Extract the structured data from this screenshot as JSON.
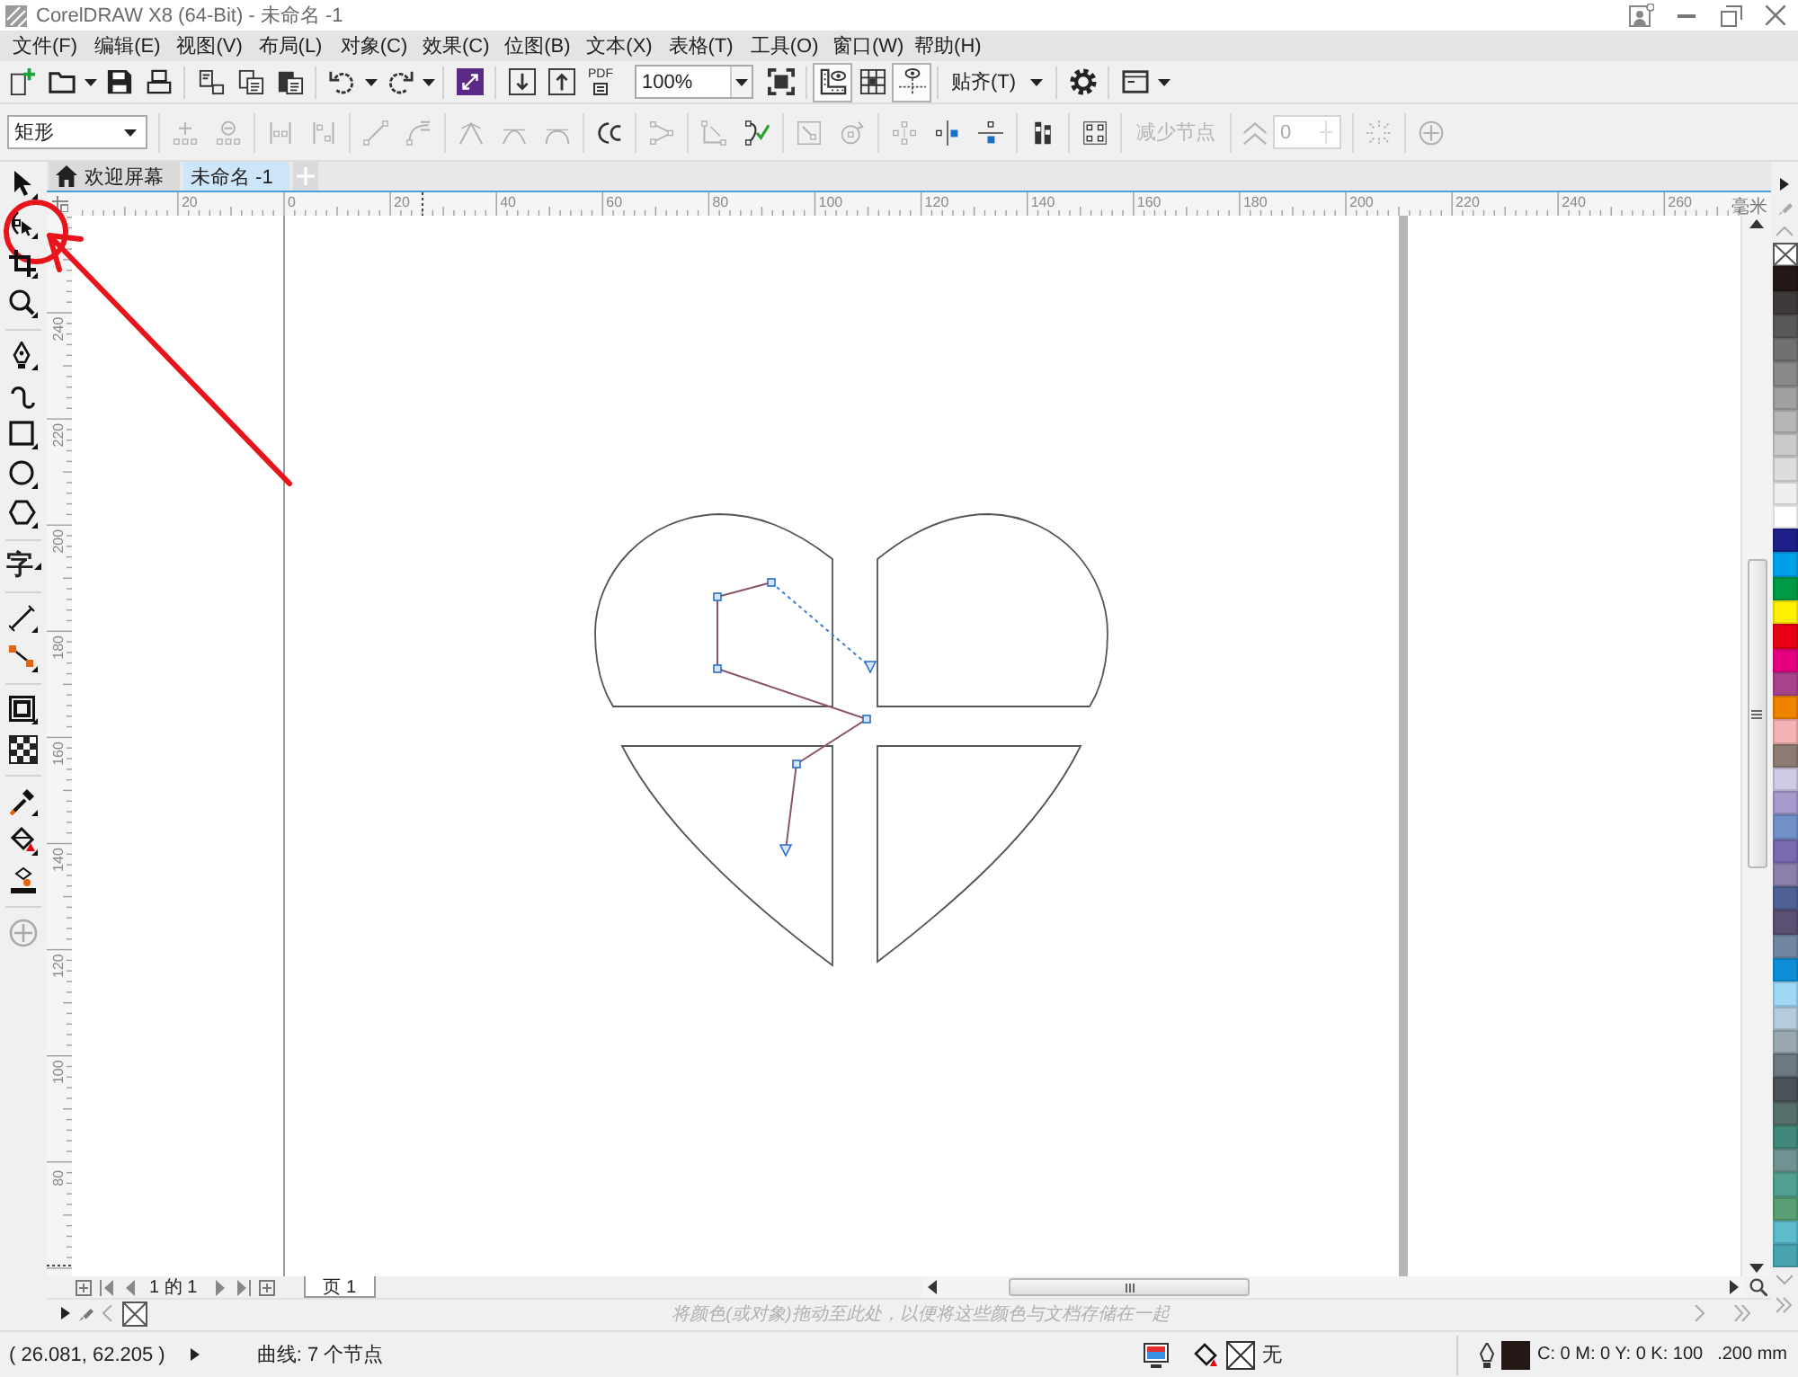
{
  "window": {
    "title": "CorelDRAW X8 (64-Bit) - 未命名 -1"
  },
  "menu": [
    "文件(F)",
    "编辑(E)",
    "视图(V)",
    "布局(L)",
    "对象(C)",
    "效果(C)",
    "位图(B)",
    "文本(X)",
    "表格(T)",
    "工具(O)",
    "窗口(W)",
    "帮助(H)"
  ],
  "toolbar": {
    "pdf_label": "PDF",
    "zoom": {
      "value": "100%"
    },
    "view_toggles": [
      {
        "selected": true
      },
      {
        "selected": false
      },
      {
        "selected": true
      }
    ],
    "snap": {
      "label": "贴齐(T)"
    }
  },
  "property_bar": {
    "object_type": {
      "value": "矩形"
    },
    "node_tools": [
      [
        {
          "disabled": true
        },
        {
          "disabled": true
        }
      ],
      [
        {
          "disabled": true
        },
        {
          "disabled": true
        }
      ],
      [
        {
          "disabled": true
        },
        {
          "disabled": true
        }
      ],
      [
        {
          "disabled": true
        },
        {
          "disabled": true
        },
        {
          "disabled": true
        }
      ],
      [
        {
          "disabled": false
        }
      ],
      [
        {
          "disabled": true
        }
      ],
      [
        {
          "disabled": true
        },
        {
          "disabled": false
        }
      ],
      [
        {
          "disabled": true
        },
        {
          "disabled": true
        }
      ],
      [
        {
          "disabled": true
        },
        {
          "disabled": false
        },
        {
          "disabled": false
        }
      ],
      [
        {
          "disabled": false
        }
      ],
      [
        {
          "disabled": false
        }
      ]
    ],
    "reduce_nodes": {
      "label": "减少节点",
      "disabled": true
    },
    "smoothness": {
      "value": "0",
      "disabled": true
    },
    "more_tools": [
      {
        "disabled": true
      },
      {
        "disabled": true
      }
    ]
  },
  "toolbox": {
    "groups": [
      [
        {
          "kind": "icon",
          "circled": false
        },
        {
          "kind": "icon",
          "circled": true
        },
        {
          "kind": "icon",
          "circled": false
        },
        {
          "kind": "icon",
          "circled": false
        }
      ],
      [
        {
          "kind": "icon",
          "circled": false
        },
        {
          "kind": "icon",
          "circled": false
        },
        {
          "kind": "icon",
          "circled": false
        },
        {
          "kind": "icon",
          "circled": false
        },
        {
          "kind": "icon",
          "circled": false
        }
      ],
      [
        {
          "kind": "glyph",
          "glyph": "字",
          "circled": false
        }
      ],
      [
        {
          "kind": "icon",
          "circled": false
        },
        {
          "kind": "icon",
          "circled": false
        }
      ],
      [
        {
          "kind": "icon",
          "circled": false
        },
        {
          "kind": "icon",
          "circled": false
        }
      ],
      [
        {
          "kind": "icon",
          "circled": false
        },
        {
          "kind": "icon",
          "circled": false
        },
        {
          "kind": "icon",
          "circled": false
        }
      ],
      [
        {
          "kind": "icon",
          "circled": false
        }
      ]
    ]
  },
  "document_tabs": [
    {
      "kind": "home",
      "label": "欢迎屏幕",
      "selected": false
    },
    {
      "kind": "document",
      "label": "未命名 -1",
      "selected": true
    }
  ],
  "rulers": {
    "horizontal": [
      "20",
      "0",
      "20",
      "40",
      "60",
      "80",
      "100",
      "120",
      "140",
      "160",
      "180",
      "200",
      "220",
      "240",
      "260"
    ],
    "unit": "毫米",
    "vertical": [
      "240",
      "220",
      "200",
      "180",
      "160",
      "140",
      "120",
      "100",
      "80"
    ]
  },
  "page_navigator": {
    "counter": "1 的 1",
    "pages": [
      {
        "label": "页 1",
        "selected": true
      }
    ]
  },
  "document_palette": {
    "placeholder": "将颜色(或对象)拖动至此处，以便将这些颜色与文档存储在一起"
  },
  "color_palette": {
    "swatches": [
      {
        "kind": "none"
      },
      {
        "kind": "color",
        "color": "#231815"
      },
      {
        "kind": "color",
        "color": "#3e3a39"
      },
      {
        "kind": "color",
        "color": "#595757"
      },
      {
        "kind": "color",
        "color": "#727171"
      },
      {
        "kind": "color",
        "color": "#898989"
      },
      {
        "kind": "color",
        "color": "#9fa0a0"
      },
      {
        "kind": "color",
        "color": "#b5b5b6"
      },
      {
        "kind": "color",
        "color": "#c9caca"
      },
      {
        "kind": "color",
        "color": "#dcdddd"
      },
      {
        "kind": "color",
        "color": "#efefef"
      },
      {
        "kind": "color",
        "color": "#ffffff"
      },
      {
        "kind": "color",
        "color": "#1d2088"
      },
      {
        "kind": "color",
        "color": "#00a0e9"
      },
      {
        "kind": "color",
        "color": "#009944"
      },
      {
        "kind": "color",
        "color": "#fff100"
      },
      {
        "kind": "color",
        "color": "#e60012"
      },
      {
        "kind": "color",
        "color": "#e4007f"
      },
      {
        "kind": "color",
        "color": "#a7428b"
      },
      {
        "kind": "color",
        "color": "#f08300"
      },
      {
        "kind": "color",
        "color": "#f5b2b2"
      },
      {
        "kind": "color",
        "color": "#8c7b70"
      },
      {
        "kind": "color",
        "color": "#d0cae4"
      },
      {
        "kind": "color",
        "color": "#a699cb"
      },
      {
        "kind": "color",
        "color": "#7290c8"
      },
      {
        "kind": "color",
        "color": "#7a69af"
      },
      {
        "kind": "color",
        "color": "#8b80ac"
      },
      {
        "kind": "color",
        "color": "#4e6192"
      },
      {
        "kind": "color",
        "color": "#5b4f74"
      },
      {
        "kind": "color",
        "color": "#7286a3"
      },
      {
        "kind": "color",
        "color": "#0e8ed6"
      },
      {
        "kind": "color",
        "color": "#9fd8f5"
      },
      {
        "kind": "color",
        "color": "#b4ccdc"
      },
      {
        "kind": "color",
        "color": "#9aa8b2"
      },
      {
        "kind": "color",
        "color": "#6d7880"
      },
      {
        "kind": "color",
        "color": "#4a5258"
      },
      {
        "kind": "color",
        "color": "#566f6b"
      },
      {
        "kind": "color",
        "color": "#41887a"
      },
      {
        "kind": "color",
        "color": "#6e9391"
      },
      {
        "kind": "color",
        "color": "#51a08f"
      },
      {
        "kind": "color",
        "color": "#58a073"
      },
      {
        "kind": "color",
        "color": "#5cbccc"
      },
      {
        "kind": "color",
        "color": "#48a4b2"
      }
    ]
  },
  "status_bar": {
    "coordinates": "( 26.081, 62.205 )",
    "selection": "曲线: 7 个节点",
    "fill": {
      "label": "无"
    },
    "outline": {
      "values": "C: 0 M: 0 Y: 0 K: 100",
      "width": ".200 mm"
    }
  }
}
